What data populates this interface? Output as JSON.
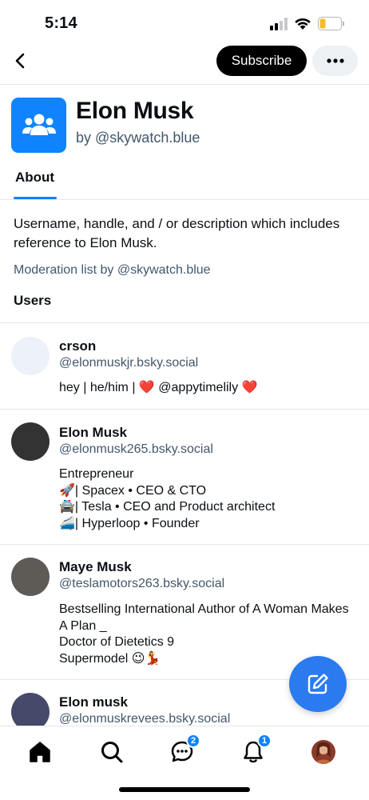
{
  "status_bar": {
    "time": "5:14"
  },
  "header": {
    "subscribe_label": "Subscribe"
  },
  "list": {
    "title": "Elon Musk",
    "byline_prefix": "by",
    "byline_handle": "@skywatch.blue",
    "tab_about": "About",
    "description": "Username, handle, and / or description which includes reference to Elon Musk.",
    "moderation_note": "Moderation list by @skywatch.blue",
    "users_heading": "Users"
  },
  "users": [
    {
      "name": "crson",
      "handle": "@elonmuskjr.bsky.social",
      "bio": "hey | he/him | ❤️ @appytimelily ❤️",
      "avatar_color": "#edf1fa"
    },
    {
      "name": "Elon Musk",
      "handle": "@elonmusk265.bsky.social",
      "bio": "Entrepreneur\n🚀| Spacex • CEO & CTO\n🚔| Tesla • CEO and Product architect\n🚄| Hyperloop • Founder",
      "avatar_color": "#333333"
    },
    {
      "name": "Maye Musk",
      "handle": "@teslamotors263.bsky.social",
      "bio": "Bestselling International Author of A Woman Makes A Plan _\nDoctor of Dietetics 9\nSupermodel 😉💃",
      "avatar_color": "#5e5a56"
    },
    {
      "name": "Elon musk",
      "handle": "@elonmuskrevees.bsky.social",
      "bio": "",
      "avatar_color": "#46496a"
    }
  ],
  "bottom_nav": {
    "chat_badge": "2",
    "notifications_badge": "1"
  },
  "colors": {
    "accent": "#1083fe",
    "fab": "#2b7bf0",
    "secondary_text": "#42576c"
  },
  "icons": {
    "back": "chevron-left-icon",
    "more": "ellipsis-icon",
    "list": "people-group-icon",
    "fab": "compose-icon",
    "nav": [
      "home-icon",
      "search-icon",
      "chat-icon",
      "bell-icon",
      "profile-avatar"
    ]
  }
}
